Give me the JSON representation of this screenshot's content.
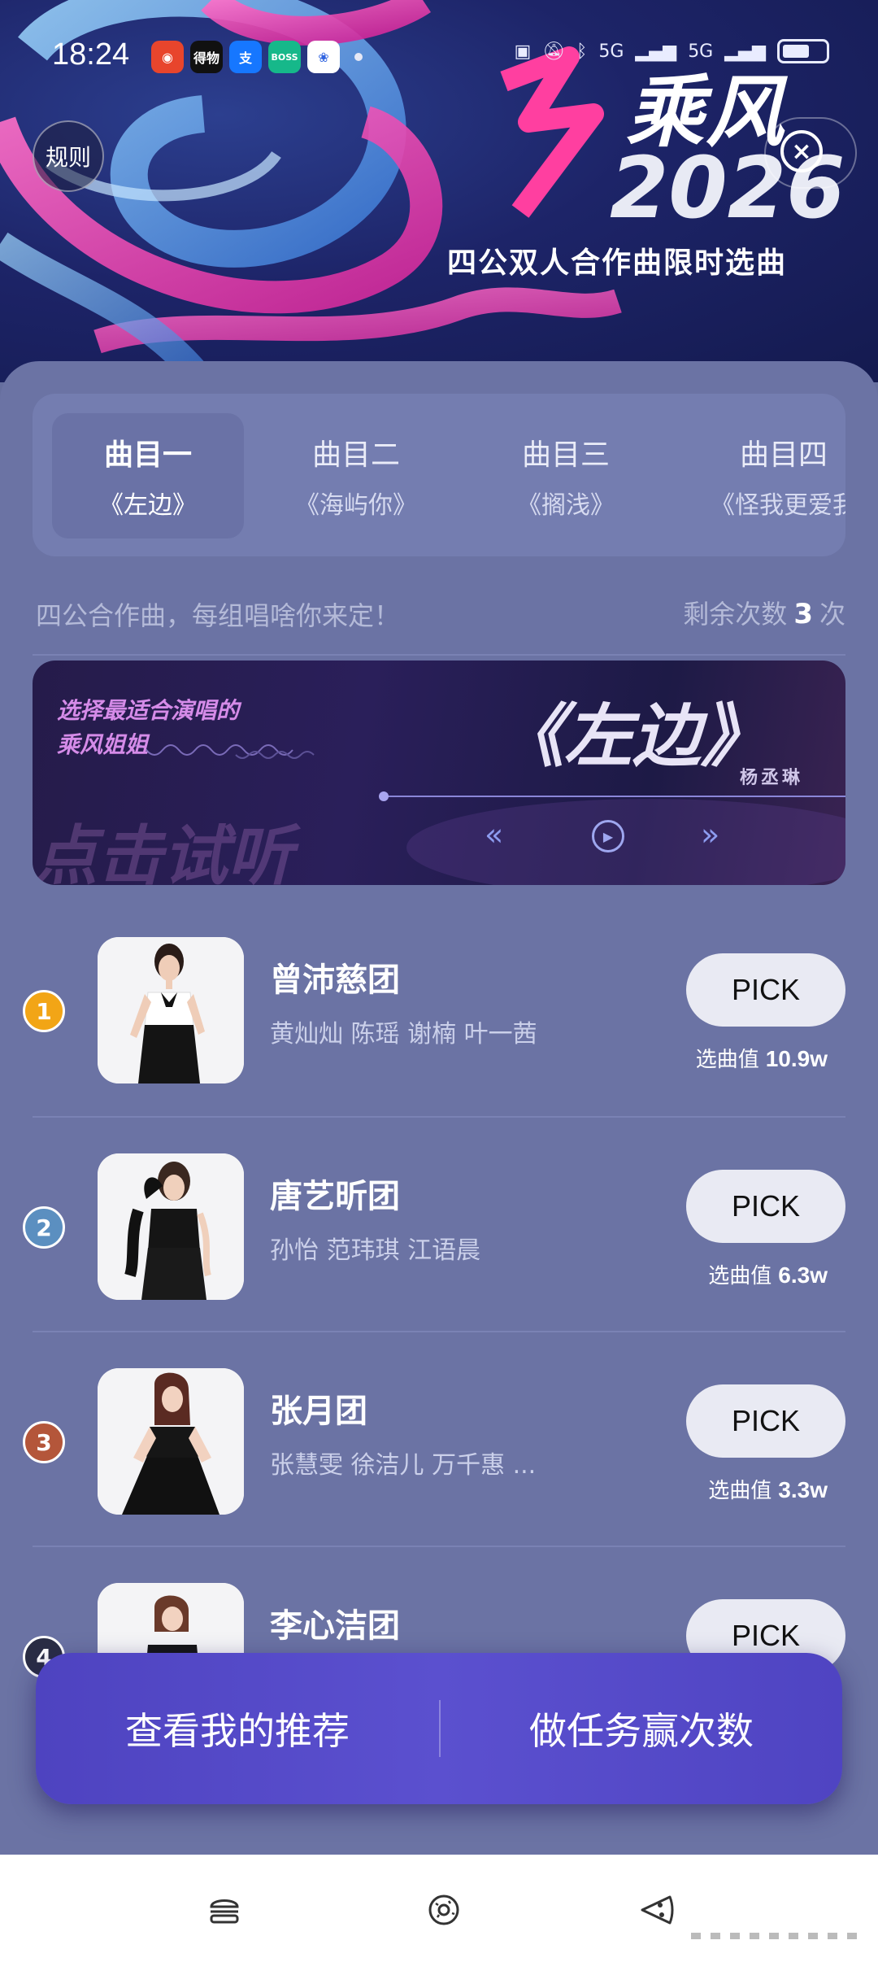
{
  "status_bar": {
    "time": "18:24",
    "apps": [
      "weibo",
      "得物",
      "支",
      "BOSS直聘",
      "baidu"
    ],
    "network": "5G"
  },
  "banner": {
    "rules_label": "规则",
    "logo_text": "乘风",
    "year": "2026",
    "subtitle": "四公双人合作曲限时选曲"
  },
  "tabs": [
    {
      "title": "曲目一",
      "song": "《左边》",
      "active": true
    },
    {
      "title": "曲目二",
      "song": "《海屿你》",
      "active": false
    },
    {
      "title": "曲目三",
      "song": "《搁浅》",
      "active": false
    },
    {
      "title": "曲目四",
      "song": "《怪我更爱我",
      "active": false
    }
  ],
  "info": {
    "tagline": "四公合作曲，每组唱啥你来定！",
    "remain_prefix": "剩余次数",
    "remain_count": "3",
    "remain_suffix": "次"
  },
  "audio_card": {
    "line1": "选择最适合演唱的",
    "line2": "乘风姐姐",
    "listen": "点击试听",
    "song": "《左边》",
    "singer": "杨丞琳"
  },
  "teams": [
    {
      "rank": "1",
      "name": "曾沛慈团",
      "members": "黄灿灿 陈瑶 谢楠 叶一茜",
      "pick": "PICK",
      "value_label": "选曲值",
      "value": "10.9w",
      "rank_color": "#f2a516"
    },
    {
      "rank": "2",
      "name": "唐艺昕团",
      "members": "孙怡 范玮琪 江语晨",
      "pick": "PICK",
      "value_label": "选曲值",
      "value": "6.3w",
      "rank_color": "#5b8fc0"
    },
    {
      "rank": "3",
      "name": "张月团",
      "members": "张慧雯 徐洁儿 万千惠 ...",
      "pick": "PICK",
      "value_label": "选曲值",
      "value": "3.3w",
      "rank_color": "#b4563a"
    },
    {
      "rank": "4",
      "name": "李心洁团",
      "members": "",
      "pick": "PICK",
      "value_label": "",
      "value": "",
      "rank_color": "#2a2d45"
    }
  ],
  "float_bar": {
    "left_label": "查看我的推荐",
    "right_label": "做任务赢次数"
  },
  "bottom_nav": [
    "burger-icon",
    "donut-icon",
    "pizza-icon"
  ]
}
